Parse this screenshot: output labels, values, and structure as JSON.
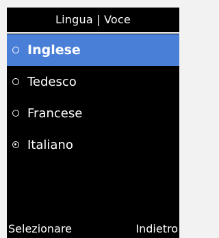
{
  "header": {
    "title": "Lingua | Voce"
  },
  "options": [
    {
      "label": "Inglese",
      "highlighted": true,
      "checked": false
    },
    {
      "label": "Tedesco",
      "highlighted": false,
      "checked": false
    },
    {
      "label": "Francese",
      "highlighted": false,
      "checked": false
    },
    {
      "label": "Italiano",
      "highlighted": false,
      "checked": true
    }
  ],
  "softkeys": {
    "left": "Selezionare",
    "right": "Indietro"
  },
  "colors": {
    "background": "#000000",
    "highlight": "#4a7fd8",
    "text": "#ffffff"
  }
}
